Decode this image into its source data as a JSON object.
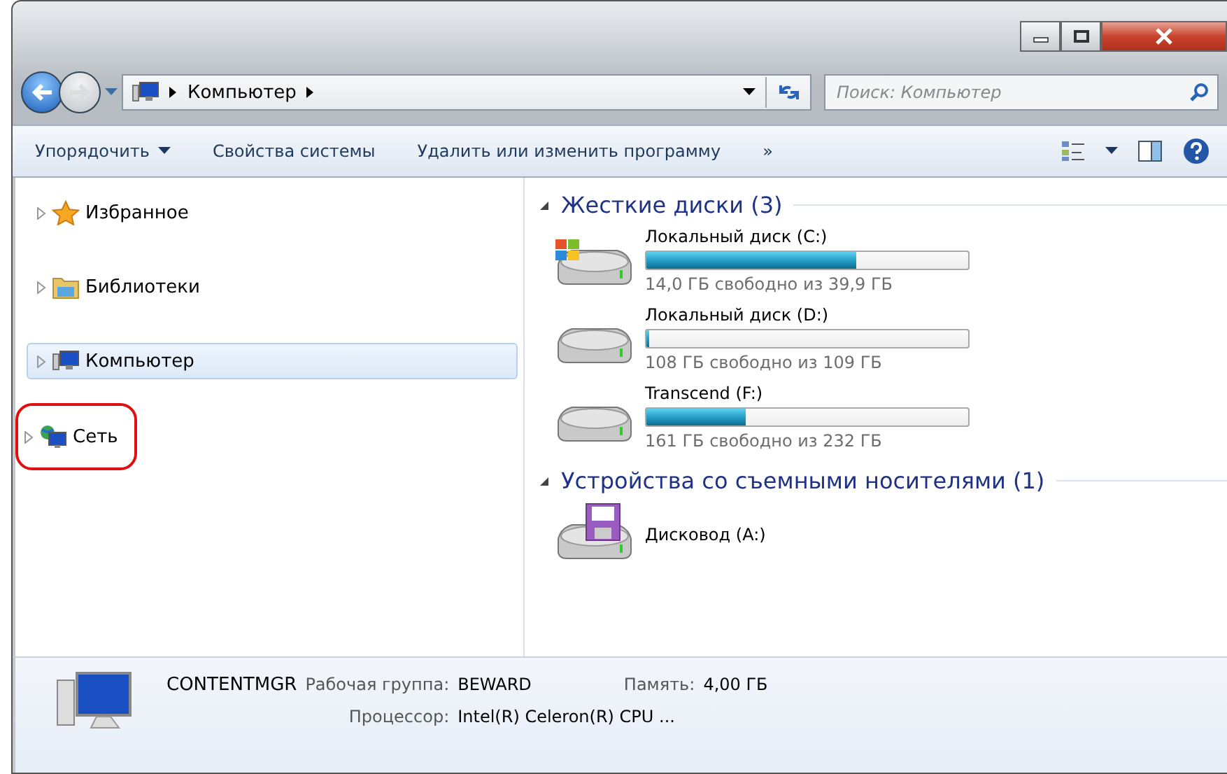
{
  "address_bar": {
    "crumbs": [
      "Компьютер"
    ]
  },
  "search": {
    "placeholder": "Поиск: Компьютер"
  },
  "toolbar": {
    "items": [
      "Упорядочить",
      "Свойства системы",
      "Удалить или изменить программу",
      "»"
    ]
  },
  "sidebar": {
    "items": [
      {
        "label": "Избранное",
        "kind": "star",
        "selected": false,
        "highlighted": false
      },
      {
        "label": "Библиотеки",
        "kind": "library",
        "selected": false,
        "highlighted": false
      },
      {
        "label": "Компьютер",
        "kind": "computer",
        "selected": true,
        "highlighted": false
      },
      {
        "label": "Сеть",
        "kind": "network",
        "selected": false,
        "highlighted": true
      }
    ]
  },
  "groups": [
    {
      "title": "Жесткие диски (3)",
      "expanded": true,
      "drives": [
        {
          "name": "Локальный диск (C:)",
          "kind": "system",
          "level": 0.65,
          "reading": "14,0 ГБ свободно из 39,9 ГБ"
        },
        {
          "name": "Локальный диск (D:)",
          "kind": "disk",
          "level": 0.01,
          "reading": "108 ГБ свободно из 109 ГБ"
        },
        {
          "name": "Transcend (F:)",
          "kind": "disk",
          "level": 0.31,
          "reading": "161 ГБ свободно из 232 ГБ"
        }
      ]
    },
    {
      "title": "Устройства со съемными носителями (1)",
      "expanded": true,
      "drives": [
        {
          "name": "Дисковод (A:)",
          "kind": "floppy"
        }
      ]
    }
  ],
  "details": {
    "computer_name": "CONTENTMGR",
    "fields": [
      {
        "label": "Рабочая группа:",
        "value": "BEWARD"
      },
      {
        "label": "Память:",
        "value": "4,00 ГБ"
      },
      {
        "label": "Процессор:",
        "value": "Intel(R) Celeron(R) CPU ..."
      }
    ]
  }
}
